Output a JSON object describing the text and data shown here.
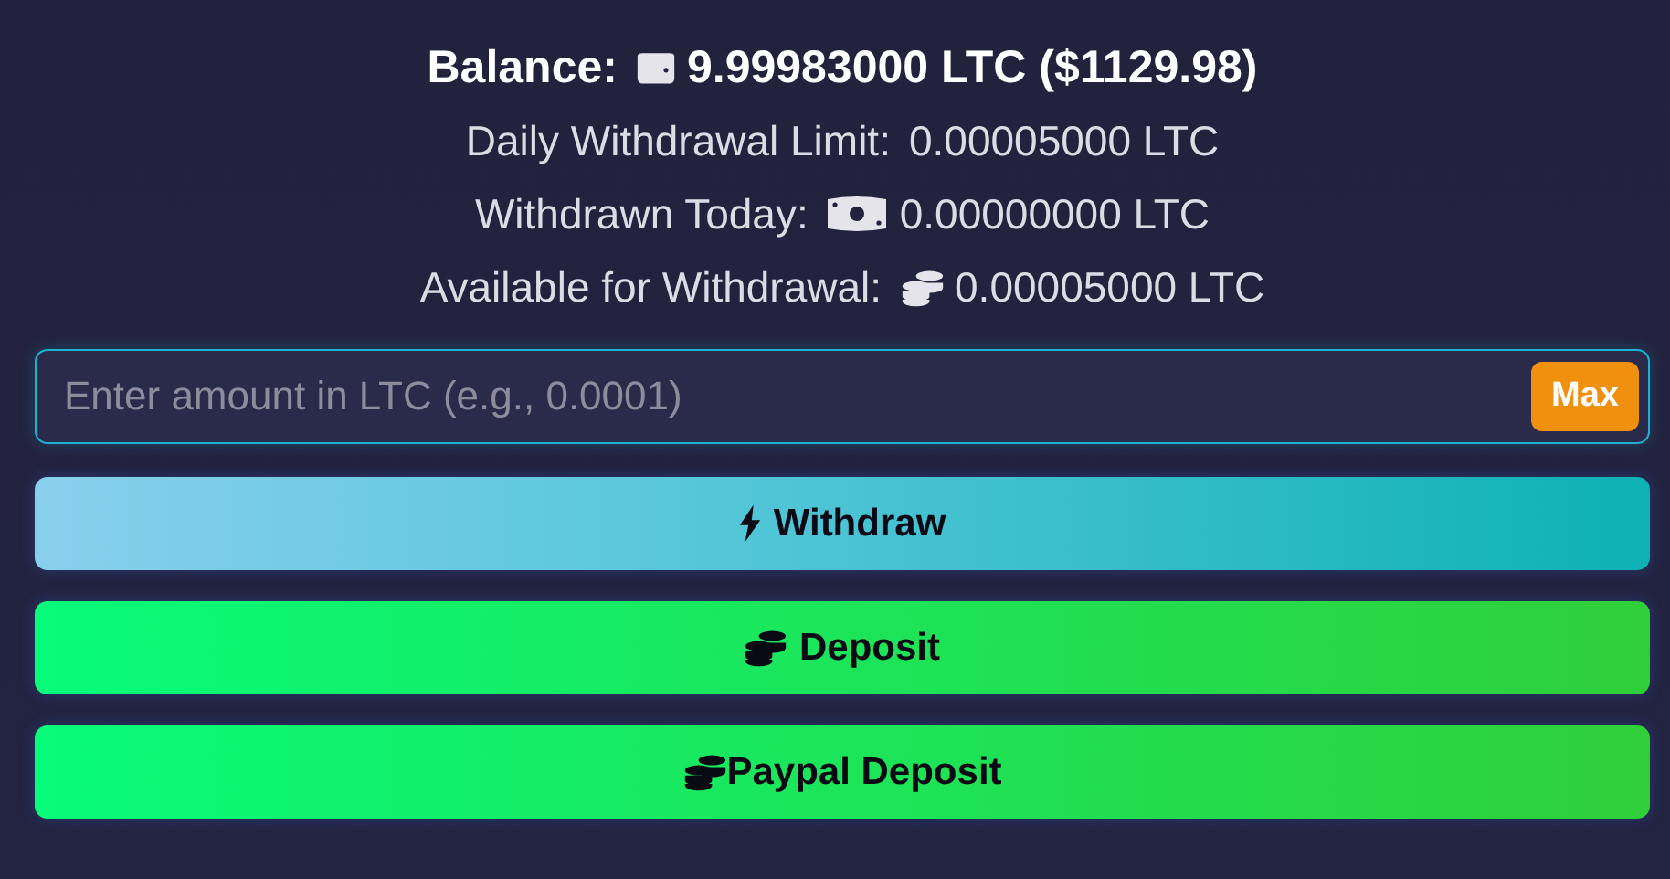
{
  "balance": {
    "label": "Balance:",
    "value": "9.99983000 LTC ($1129.98)"
  },
  "stats": [
    {
      "label": "Daily Withdrawal Limit:",
      "kind": "limit",
      "value": "0.00005000 LTC"
    },
    {
      "label": "Withdrawn Today:",
      "kind": "withdrawn",
      "value": "0.00000000 LTC"
    },
    {
      "label": "Available for Withdrawal:",
      "kind": "available",
      "value": "0.00005000 LTC"
    }
  ],
  "amount": {
    "placeholder": "Enter amount in LTC (e.g., 0.0001)",
    "max_button": "Max"
  },
  "buttons": [
    {
      "label": "Withdraw",
      "kind": "withdraw"
    },
    {
      "label": "Deposit",
      "kind": "deposit"
    },
    {
      "label": "Paypal Deposit",
      "kind": "paypal"
    }
  ]
}
